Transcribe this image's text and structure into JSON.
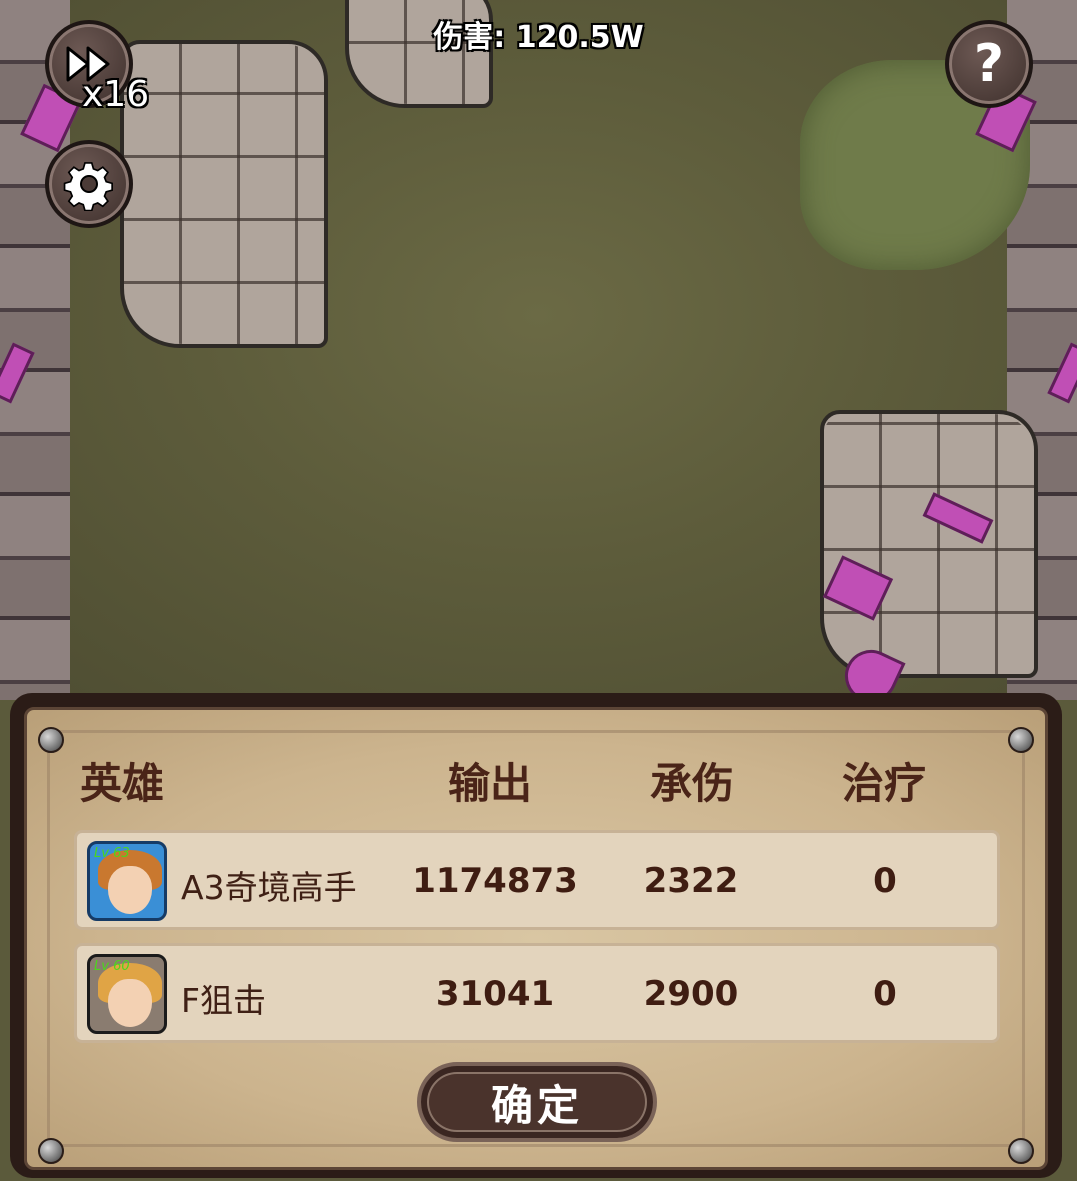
{
  "hud": {
    "damage_text": "伤害: 120.5W",
    "speed_label": "x16",
    "help_label": "?"
  },
  "result_panel": {
    "headers": {
      "hero": "英雄",
      "output": "输出",
      "damage_taken": "承伤",
      "healing": "治疗"
    },
    "rows": [
      {
        "level": "Lv 63",
        "name": "A3奇境高手",
        "output": "1174873",
        "damage_taken": "2322",
        "healing": "0"
      },
      {
        "level": "Lv 60",
        "name": "F狙击",
        "output": "31041",
        "damage_taken": "2900",
        "healing": "0"
      }
    ],
    "confirm_label": "确定"
  },
  "colors": {
    "panel_bg": "#ccb48e",
    "header_text": "#4a2418",
    "crystal": "#c04fb5"
  },
  "icons": {
    "fast_forward": "fast-forward-icon",
    "settings": "gear-icon",
    "help": "question-mark-icon"
  }
}
